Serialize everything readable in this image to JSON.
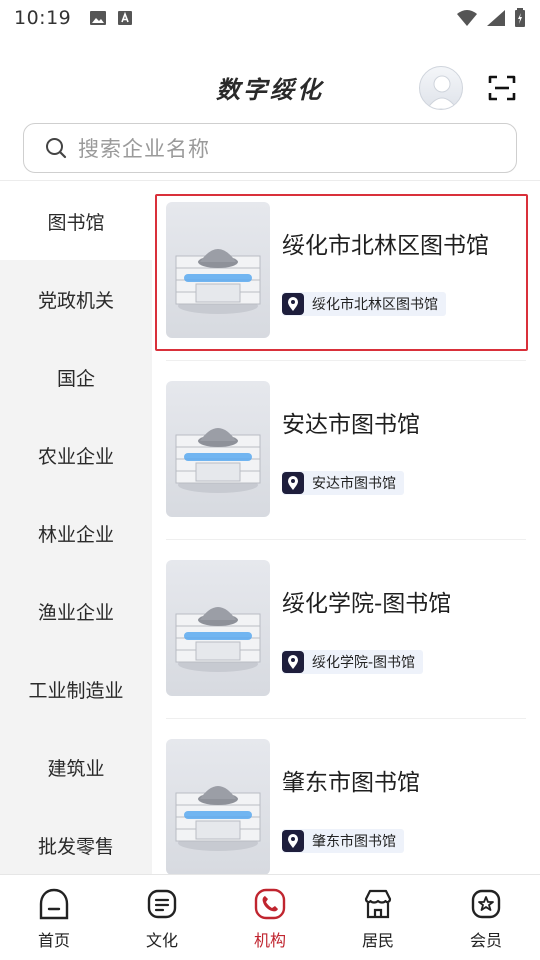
{
  "status_bar": {
    "time": "10:19"
  },
  "header": {
    "title": "数字绥化"
  },
  "search": {
    "placeholder": "搜索企业名称"
  },
  "sidebar": {
    "items": [
      {
        "label": "图书馆",
        "active": true
      },
      {
        "label": "党政机关"
      },
      {
        "label": "国企"
      },
      {
        "label": "农业企业"
      },
      {
        "label": "林业企业"
      },
      {
        "label": "渔业企业"
      },
      {
        "label": "工业制造业"
      },
      {
        "label": "建筑业"
      },
      {
        "label": "批发零售"
      }
    ]
  },
  "list": {
    "items": [
      {
        "title": "绥化市北林区图书馆",
        "tag": "绥化市北林区图书馆"
      },
      {
        "title": "安达市图书馆",
        "tag": "安达市图书馆"
      },
      {
        "title": "绥化学院-图书馆",
        "tag": "绥化学院-图书馆"
      },
      {
        "title": "肇东市图书馆",
        "tag": "肇东市图书馆"
      }
    ]
  },
  "bottom_nav": {
    "items": [
      {
        "label": "首页",
        "icon": "home-face-icon"
      },
      {
        "label": "文化",
        "icon": "document-icon"
      },
      {
        "label": "机构",
        "icon": "phone-icon",
        "active": true
      },
      {
        "label": "居民",
        "icon": "shop-icon"
      },
      {
        "label": "会员",
        "icon": "star-badge-icon"
      }
    ]
  },
  "colors": {
    "accent": "#c0252f",
    "highlight_border": "#d9303a"
  }
}
